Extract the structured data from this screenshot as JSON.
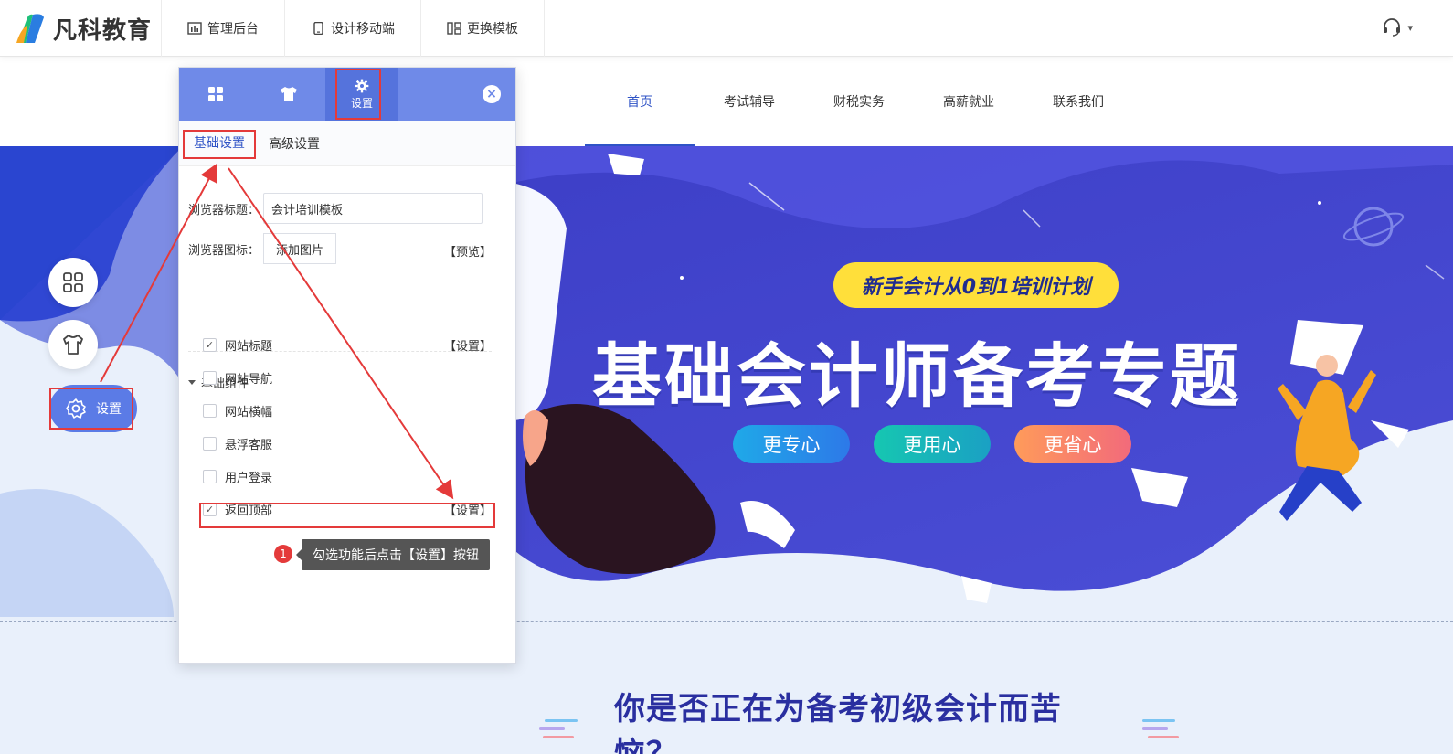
{
  "topbar": {
    "logo_text": "凡科教育",
    "nav": [
      {
        "label": "管理后台",
        "icon": "chart-icon"
      },
      {
        "label": "设计移动端",
        "icon": "mobile-icon"
      },
      {
        "label": "更换模板",
        "icon": "template-icon"
      }
    ],
    "support_icon": "headset-icon"
  },
  "site_nav": {
    "items": [
      "首页",
      "考试辅导",
      "财税实务",
      "高薪就业",
      "联系我们"
    ],
    "active_index": 0
  },
  "banner": {
    "tag": "新手会计从0到1培训计划",
    "title": "基础会计师备考专题",
    "pills": [
      "更专心",
      "更用心",
      "更省心"
    ]
  },
  "question": "你是否正在为备考初级会计而苦恼？",
  "float_tools": {
    "settings_label": "设置"
  },
  "panel": {
    "active_tab_label": "设置",
    "close_label": "×",
    "sub_tabs": [
      "基础设置",
      "高级设置"
    ],
    "browser_title_label": "浏览器标题：",
    "browser_title_value": "会计培训模板",
    "browser_icon_label": "浏览器图标：",
    "add_image_label": "添加图片",
    "preview_label": "【预览】",
    "group_title": "基础组件",
    "components": [
      {
        "label": "网站标题",
        "checked": true,
        "setting": "【设置】"
      },
      {
        "label": "网站导航",
        "checked": false,
        "setting": ""
      },
      {
        "label": "网站横幅",
        "checked": false,
        "setting": ""
      },
      {
        "label": "悬浮客服",
        "checked": false,
        "setting": ""
      },
      {
        "label": "用户登录",
        "checked": false,
        "setting": ""
      },
      {
        "label": "返回顶部",
        "checked": true,
        "setting": "【设置】"
      }
    ]
  },
  "annotation": {
    "step": "1",
    "text": "勾选功能后点击【设置】按钮",
    "color": "#e43a3a"
  },
  "colors": {
    "brand_blue": "#2f53c6",
    "panel_header": "#6f8ae8",
    "banner_blue": "#4a44c9",
    "tag_yellow": "#ffdf3a"
  }
}
